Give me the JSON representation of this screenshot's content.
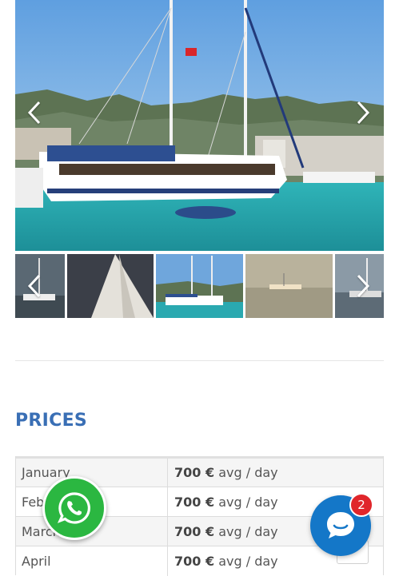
{
  "gallery": {
    "prev_icon": "chevron-left-icon",
    "next_icon": "chevron-right-icon",
    "thumbnail_count": 5,
    "colors": {
      "sky": "#7fb7e6",
      "sea": "#2aa9b0",
      "hull": "#ffffff",
      "mountain": "#556b4f"
    }
  },
  "prices": {
    "title": "PRICES",
    "rows": [
      {
        "month": "January",
        "amount": "700 €",
        "unit": "avg / day"
      },
      {
        "month": "February",
        "amount": "700 €",
        "unit": "avg / day"
      },
      {
        "month": "March",
        "amount": "700 €",
        "unit": "avg / day"
      },
      {
        "month": "April",
        "amount": "700 €",
        "unit": "avg / day"
      }
    ]
  },
  "widgets": {
    "whatsapp_icon": "whatsapp-icon",
    "chat_icon": "chat-bubble-icon",
    "chat_badge": "2",
    "colors": {
      "whatsapp": "#2bb741",
      "chat": "#1477c8",
      "badge": "#e0262b",
      "title": "#3a6fb5"
    }
  }
}
